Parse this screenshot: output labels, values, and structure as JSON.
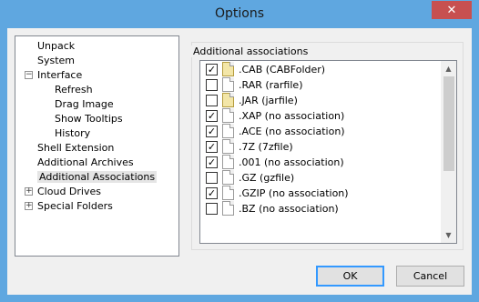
{
  "window": {
    "title": "Options",
    "close": "✕"
  },
  "tree": {
    "items": [
      {
        "label": "Unpack",
        "level": 0,
        "expander": null,
        "selected": false
      },
      {
        "label": "System",
        "level": 0,
        "expander": null,
        "selected": false
      },
      {
        "label": "Interface",
        "level": 0,
        "expander": "−",
        "selected": false
      },
      {
        "label": "Refresh",
        "level": 1,
        "expander": null,
        "selected": false
      },
      {
        "label": "Drag Image",
        "level": 1,
        "expander": null,
        "selected": false
      },
      {
        "label": "Show Tooltips",
        "level": 1,
        "expander": null,
        "selected": false
      },
      {
        "label": "History",
        "level": 1,
        "expander": null,
        "selected": false
      },
      {
        "label": "Shell Extension",
        "level": 0,
        "expander": null,
        "selected": false
      },
      {
        "label": "Additional Archives",
        "level": 0,
        "expander": null,
        "selected": false
      },
      {
        "label": "Additional Associations",
        "level": 0,
        "expander": null,
        "selected": true
      },
      {
        "label": "Cloud Drives",
        "level": 0,
        "expander": "+",
        "selected": false
      },
      {
        "label": "Special Folders",
        "level": 0,
        "expander": "+",
        "selected": false
      }
    ]
  },
  "associations": {
    "group_title": "Additional associations",
    "rows": [
      {
        "label": ".CAB  (CABFolder)",
        "checked": true,
        "icon": "archive-file-icon"
      },
      {
        "label": ".RAR  (rarfile)",
        "checked": false,
        "icon": "file-icon"
      },
      {
        "label": ".JAR  (jarfile)",
        "checked": false,
        "icon": "java-file-icon"
      },
      {
        "label": ".XAP  (no association)",
        "checked": true,
        "icon": "file-icon"
      },
      {
        "label": ".ACE  (no association)",
        "checked": true,
        "icon": "file-icon"
      },
      {
        "label": ".7Z  (7zfile)",
        "checked": true,
        "icon": "file-icon"
      },
      {
        "label": ".001  (no association)",
        "checked": true,
        "icon": "file-icon"
      },
      {
        "label": ".GZ  (gzfile)",
        "checked": false,
        "icon": "file-icon"
      },
      {
        "label": ".GZIP  (no association)",
        "checked": true,
        "icon": "file-icon"
      },
      {
        "label": ".BZ  (no association)",
        "checked": false,
        "icon": "file-icon"
      }
    ]
  },
  "scrollbar": {
    "up": "▲",
    "down": "▼"
  },
  "buttons": {
    "ok": "OK",
    "cancel": "Cancel"
  }
}
